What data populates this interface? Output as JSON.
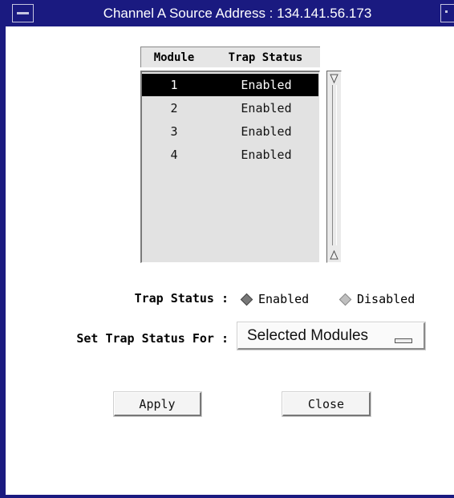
{
  "window": {
    "title": "Channel A Source Address : 134.141.56.173",
    "menu_icon": "window-menu-icon",
    "maximize_icon": "window-maximize-icon"
  },
  "table": {
    "columns": [
      "Module",
      "Trap Status"
    ],
    "rows": [
      {
        "module": "1",
        "status": "Enabled",
        "selected": true
      },
      {
        "module": "2",
        "status": "Enabled",
        "selected": false
      },
      {
        "module": "3",
        "status": "Enabled",
        "selected": false
      },
      {
        "module": "4",
        "status": "Enabled",
        "selected": false
      }
    ]
  },
  "trap_status": {
    "label": "Trap Status :",
    "options": [
      "Enabled",
      "Disabled"
    ],
    "selected": "Enabled"
  },
  "set_for": {
    "label": "Set Trap Status For :",
    "value": "Selected Modules"
  },
  "buttons": {
    "apply": "Apply",
    "close": "Close"
  },
  "colors": {
    "titlebar": "#1a1a80",
    "selection": "#000000"
  }
}
